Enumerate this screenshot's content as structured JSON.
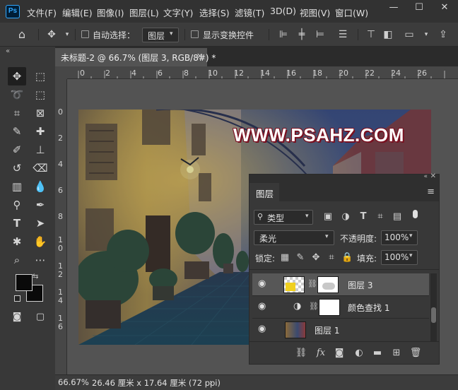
{
  "app": {
    "logo": "Ps"
  },
  "menu": {
    "items": [
      "文件(F)",
      "编辑(E)",
      "图像(I)",
      "图层(L)",
      "文字(Y)",
      "选择(S)",
      "滤镜(T)",
      "3D(D)",
      "视图(V)",
      "窗口(W)"
    ],
    "window_controls": [
      "—",
      "☐",
      "✕"
    ]
  },
  "options": {
    "auto_select_label": "自动选择：",
    "auto_select_value": "图层",
    "show_transform_label": "显示变换控件"
  },
  "document": {
    "tab_label": "未标题-2 @ 66.7% (图层 3, RGB/8#) *",
    "tab_close": "✕",
    "watermark": "WWW.PSAHZ.COM"
  },
  "ruler": {
    "h_labels": [
      "0",
      "2",
      "4",
      "6",
      "8",
      "10",
      "12",
      "14",
      "16",
      "18",
      "20",
      "22",
      "24",
      "26"
    ],
    "v_labels": [
      "0",
      "2",
      "4",
      "6",
      "8",
      "1\n0",
      "1\n2",
      "1\n4",
      "1\n6"
    ]
  },
  "status": {
    "zoom": "66.67%",
    "doc_size": "26.46 厘米 x 17.64 厘米 (72 ppi)"
  },
  "panel": {
    "title": "图层",
    "filter_label": "类型",
    "blend_mode": "柔光",
    "opacity_label": "不透明度:",
    "opacity_value": "100%",
    "lock_label": "锁定:",
    "fill_label": "填充:",
    "fill_value": "100%",
    "layers": [
      {
        "name": "图层 3",
        "selected": true
      },
      {
        "name": "颜色查找 1",
        "selected": false
      },
      {
        "name": "图层 1",
        "selected": false
      }
    ]
  },
  "colors": {
    "accent": "#31a8ff",
    "foreground_swatch": "#0a0a0a",
    "background_swatch": "#0a0a0a",
    "watermark_outline": "#7a1020",
    "selected_layer": "#575757"
  }
}
